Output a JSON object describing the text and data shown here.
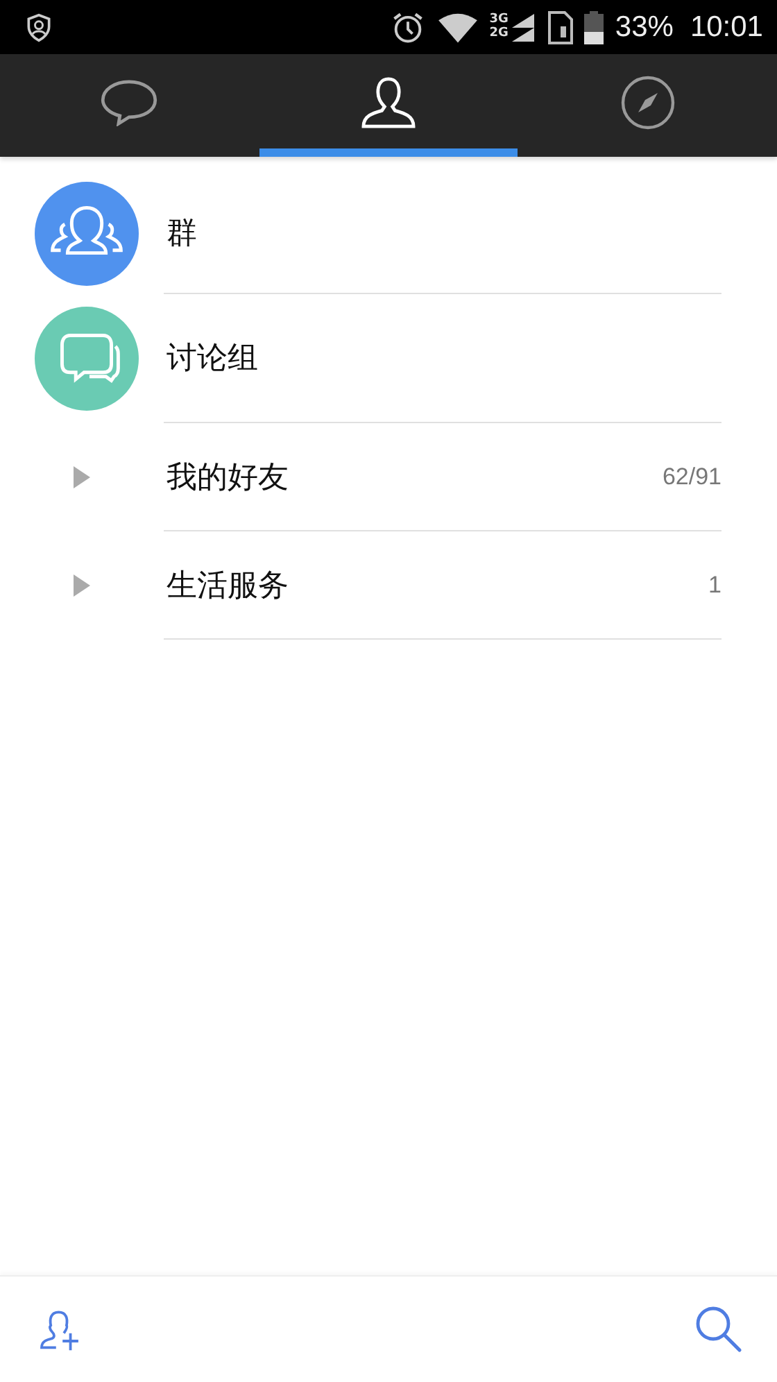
{
  "status_bar": {
    "network_top": "3G",
    "network_bottom": "2G",
    "battery": "33%",
    "time": "10:01"
  },
  "tabs": [
    {
      "kind": "chat",
      "selected": false
    },
    {
      "kind": "contacts",
      "selected": true
    },
    {
      "kind": "discover",
      "selected": false
    }
  ],
  "entries": [
    {
      "kind": "groups",
      "label": "群",
      "color": "#5092ee"
    },
    {
      "kind": "discussion",
      "label": "讨论组",
      "color": "#6acbb3"
    }
  ],
  "friend_groups": [
    {
      "label": "我的好友",
      "count": "62/91",
      "expanded": false
    },
    {
      "label": "生活服务",
      "count": "1",
      "expanded": false
    }
  ]
}
